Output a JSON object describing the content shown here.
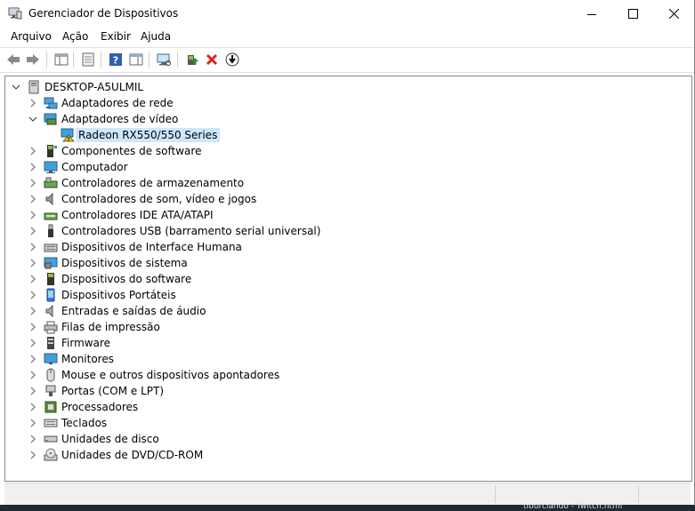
{
  "window": {
    "title": "Gerenciador de Dispositivos"
  },
  "menu": [
    "Arquivo",
    "Ação",
    "Exibir",
    "Ajuda"
  ],
  "toolbar": {
    "buttons": [
      "back-arrow-icon",
      "forward-arrow-icon",
      "show-hide-console-tree-icon",
      "properties-icon",
      "help-icon",
      "action-pane-icon",
      "scan-hardware-icon",
      "update-driver-icon",
      "uninstall-device-icon",
      "disable-device-icon"
    ]
  },
  "tree": {
    "root": "DESKTOP-A5ULMIL",
    "categories": [
      {
        "label": "Adaptadores de rede",
        "icon": "network-adapter-icon",
        "expanded": false
      },
      {
        "label": "Adaptadores de vídeo",
        "icon": "display-adapter-icon",
        "expanded": true,
        "children": [
          {
            "label": "Radeon RX550/550 Series",
            "icon": "display-adapter-warning-icon",
            "selected": true
          }
        ]
      },
      {
        "label": "Componentes de software",
        "icon": "software-component-icon",
        "expanded": false
      },
      {
        "label": "Computador",
        "icon": "computer-icon",
        "expanded": false
      },
      {
        "label": "Controladores de armazenamento",
        "icon": "storage-controller-icon",
        "expanded": false
      },
      {
        "label": "Controladores de som, vídeo e jogos",
        "icon": "sound-icon",
        "expanded": false
      },
      {
        "label": "Controladores IDE ATA/ATAPI",
        "icon": "ide-controller-icon",
        "expanded": false
      },
      {
        "label": "Controladores USB (barramento serial universal)",
        "icon": "usb-icon",
        "expanded": false
      },
      {
        "label": "Dispositivos de Interface Humana",
        "icon": "hid-icon",
        "expanded": false
      },
      {
        "label": "Dispositivos de sistema",
        "icon": "system-device-icon",
        "expanded": false
      },
      {
        "label": "Dispositivos do software",
        "icon": "software-device-icon",
        "expanded": false
      },
      {
        "label": "Dispositivos Portáteis",
        "icon": "portable-device-icon",
        "expanded": false
      },
      {
        "label": "Entradas e saídas de áudio",
        "icon": "audio-io-icon",
        "expanded": false
      },
      {
        "label": "Filas de impressão",
        "icon": "printer-icon",
        "expanded": false
      },
      {
        "label": "Firmware",
        "icon": "firmware-icon",
        "expanded": false
      },
      {
        "label": "Monitores",
        "icon": "monitor-icon",
        "expanded": false
      },
      {
        "label": "Mouse e outros dispositivos apontadores",
        "icon": "mouse-icon",
        "expanded": false
      },
      {
        "label": "Portas (COM e LPT)",
        "icon": "port-icon",
        "expanded": false
      },
      {
        "label": "Processadores",
        "icon": "processor-icon",
        "expanded": false
      },
      {
        "label": "Teclados",
        "icon": "keyboard-icon",
        "expanded": false
      },
      {
        "label": "Unidades de disco",
        "icon": "disk-drive-icon",
        "expanded": false
      },
      {
        "label": "Unidades de DVD/CD-ROM",
        "icon": "dvd-drive-icon",
        "expanded": false
      }
    ]
  },
  "background": {
    "taskbar_text": "tiburciando - Twitch.html"
  },
  "colors": {
    "selection": "#cce8ff",
    "window_bg": "#ffffff",
    "tree_border": "#828790"
  }
}
